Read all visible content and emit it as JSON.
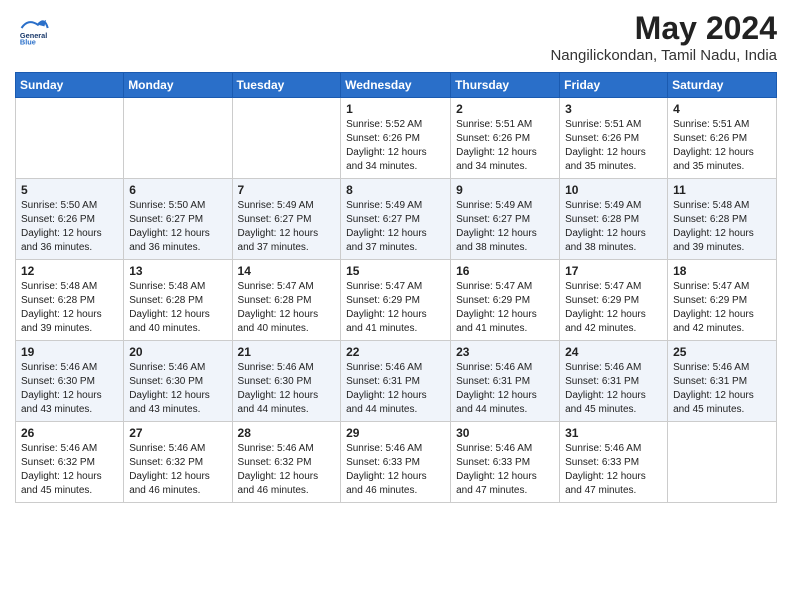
{
  "logo": {
    "line1": "General",
    "line2": "Blue"
  },
  "title": "May 2024",
  "subtitle": "Nangilickondan, Tamil Nadu, India",
  "weekdays": [
    "Sunday",
    "Monday",
    "Tuesday",
    "Wednesday",
    "Thursday",
    "Friday",
    "Saturday"
  ],
  "weeks": [
    [
      {
        "day": "",
        "info": ""
      },
      {
        "day": "",
        "info": ""
      },
      {
        "day": "",
        "info": ""
      },
      {
        "day": "1",
        "info": "Sunrise: 5:52 AM\nSunset: 6:26 PM\nDaylight: 12 hours\nand 34 minutes."
      },
      {
        "day": "2",
        "info": "Sunrise: 5:51 AM\nSunset: 6:26 PM\nDaylight: 12 hours\nand 34 minutes."
      },
      {
        "day": "3",
        "info": "Sunrise: 5:51 AM\nSunset: 6:26 PM\nDaylight: 12 hours\nand 35 minutes."
      },
      {
        "day": "4",
        "info": "Sunrise: 5:51 AM\nSunset: 6:26 PM\nDaylight: 12 hours\nand 35 minutes."
      }
    ],
    [
      {
        "day": "5",
        "info": "Sunrise: 5:50 AM\nSunset: 6:26 PM\nDaylight: 12 hours\nand 36 minutes."
      },
      {
        "day": "6",
        "info": "Sunrise: 5:50 AM\nSunset: 6:27 PM\nDaylight: 12 hours\nand 36 minutes."
      },
      {
        "day": "7",
        "info": "Sunrise: 5:49 AM\nSunset: 6:27 PM\nDaylight: 12 hours\nand 37 minutes."
      },
      {
        "day": "8",
        "info": "Sunrise: 5:49 AM\nSunset: 6:27 PM\nDaylight: 12 hours\nand 37 minutes."
      },
      {
        "day": "9",
        "info": "Sunrise: 5:49 AM\nSunset: 6:27 PM\nDaylight: 12 hours\nand 38 minutes."
      },
      {
        "day": "10",
        "info": "Sunrise: 5:49 AM\nSunset: 6:28 PM\nDaylight: 12 hours\nand 38 minutes."
      },
      {
        "day": "11",
        "info": "Sunrise: 5:48 AM\nSunset: 6:28 PM\nDaylight: 12 hours\nand 39 minutes."
      }
    ],
    [
      {
        "day": "12",
        "info": "Sunrise: 5:48 AM\nSunset: 6:28 PM\nDaylight: 12 hours\nand 39 minutes."
      },
      {
        "day": "13",
        "info": "Sunrise: 5:48 AM\nSunset: 6:28 PM\nDaylight: 12 hours\nand 40 minutes."
      },
      {
        "day": "14",
        "info": "Sunrise: 5:47 AM\nSunset: 6:28 PM\nDaylight: 12 hours\nand 40 minutes."
      },
      {
        "day": "15",
        "info": "Sunrise: 5:47 AM\nSunset: 6:29 PM\nDaylight: 12 hours\nand 41 minutes."
      },
      {
        "day": "16",
        "info": "Sunrise: 5:47 AM\nSunset: 6:29 PM\nDaylight: 12 hours\nand 41 minutes."
      },
      {
        "day": "17",
        "info": "Sunrise: 5:47 AM\nSunset: 6:29 PM\nDaylight: 12 hours\nand 42 minutes."
      },
      {
        "day": "18",
        "info": "Sunrise: 5:47 AM\nSunset: 6:29 PM\nDaylight: 12 hours\nand 42 minutes."
      }
    ],
    [
      {
        "day": "19",
        "info": "Sunrise: 5:46 AM\nSunset: 6:30 PM\nDaylight: 12 hours\nand 43 minutes."
      },
      {
        "day": "20",
        "info": "Sunrise: 5:46 AM\nSunset: 6:30 PM\nDaylight: 12 hours\nand 43 minutes."
      },
      {
        "day": "21",
        "info": "Sunrise: 5:46 AM\nSunset: 6:30 PM\nDaylight: 12 hours\nand 44 minutes."
      },
      {
        "day": "22",
        "info": "Sunrise: 5:46 AM\nSunset: 6:31 PM\nDaylight: 12 hours\nand 44 minutes."
      },
      {
        "day": "23",
        "info": "Sunrise: 5:46 AM\nSunset: 6:31 PM\nDaylight: 12 hours\nand 44 minutes."
      },
      {
        "day": "24",
        "info": "Sunrise: 5:46 AM\nSunset: 6:31 PM\nDaylight: 12 hours\nand 45 minutes."
      },
      {
        "day": "25",
        "info": "Sunrise: 5:46 AM\nSunset: 6:31 PM\nDaylight: 12 hours\nand 45 minutes."
      }
    ],
    [
      {
        "day": "26",
        "info": "Sunrise: 5:46 AM\nSunset: 6:32 PM\nDaylight: 12 hours\nand 45 minutes."
      },
      {
        "day": "27",
        "info": "Sunrise: 5:46 AM\nSunset: 6:32 PM\nDaylight: 12 hours\nand 46 minutes."
      },
      {
        "day": "28",
        "info": "Sunrise: 5:46 AM\nSunset: 6:32 PM\nDaylight: 12 hours\nand 46 minutes."
      },
      {
        "day": "29",
        "info": "Sunrise: 5:46 AM\nSunset: 6:33 PM\nDaylight: 12 hours\nand 46 minutes."
      },
      {
        "day": "30",
        "info": "Sunrise: 5:46 AM\nSunset: 6:33 PM\nDaylight: 12 hours\nand 47 minutes."
      },
      {
        "day": "31",
        "info": "Sunrise: 5:46 AM\nSunset: 6:33 PM\nDaylight: 12 hours\nand 47 minutes."
      },
      {
        "day": "",
        "info": ""
      }
    ]
  ]
}
